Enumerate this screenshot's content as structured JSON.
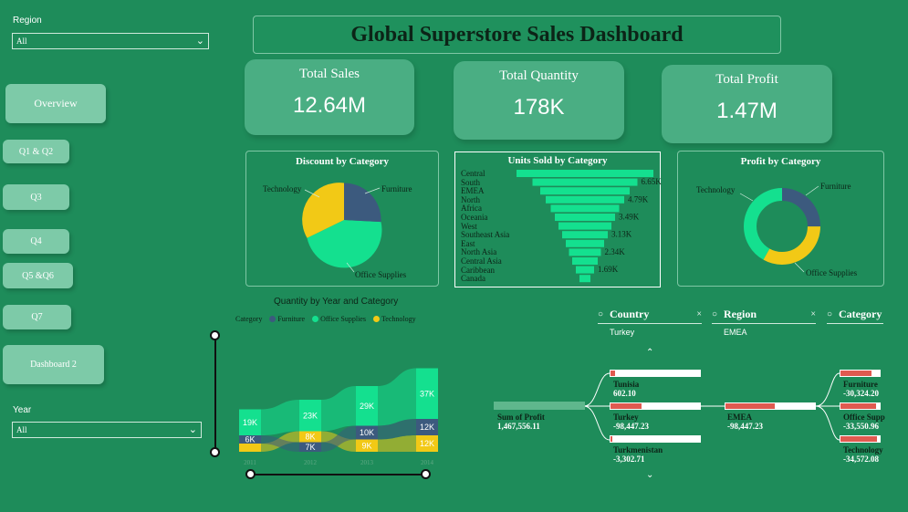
{
  "title": "Global Superstore Sales Dashboard",
  "slicers": {
    "region_label": "Region",
    "region_value": "All",
    "year_label": "Year",
    "year_value": "All"
  },
  "nav": {
    "overview": "Overview",
    "q1q2": "Q1 & Q2",
    "q3": "Q3",
    "q4": "Q4",
    "q5q6": "Q5 &Q6",
    "q7": "Q7",
    "dashboard2": "Dashboard 2"
  },
  "kpis": {
    "sales_label": "Total Sales",
    "sales_value": "12.64M",
    "qty_label": "Total Quantity",
    "qty_value": "178K",
    "profit_label": "Total Profit",
    "profit_value": "1.47M"
  },
  "discount_chart": {
    "title": "Discount by Category",
    "labels": {
      "tech": "Technology",
      "furn": "Furniture",
      "office": "Office Supplies"
    }
  },
  "units_chart": {
    "title": "Units Sold by Category",
    "rows": [
      "Central",
      "South",
      "EMEA",
      "North",
      "Africa",
      "Oceania",
      "West",
      "Southeast Asia",
      "East",
      "North Asia",
      "Central Asia",
      "Caribbean",
      "Canada"
    ],
    "values": [
      "6.65K",
      "4.79K",
      "3.49K",
      "3.13K",
      "2.34K",
      "1.69K"
    ]
  },
  "profit_chart": {
    "title": "Profit by Category",
    "labels": {
      "tech": "Technology",
      "furn": "Furniture",
      "office": "Office Supplies"
    }
  },
  "ribbon_chart": {
    "title": "Quantity by Year and Category",
    "legend_title": "Category",
    "legend": [
      "Furniture",
      "Office Supplies",
      "Technology"
    ],
    "years": [
      "2011",
      "2012",
      "2013",
      "2014"
    ],
    "labels": {
      "office": [
        "19K",
        "23K",
        "29K",
        "37K"
      ],
      "tech": [
        "",
        "8K",
        "9K",
        "12K"
      ],
      "furn": [
        "6K",
        "7K",
        "10K",
        "12K"
      ]
    }
  },
  "chart_data": [
    {
      "type": "pie",
      "title": "Discount by Category",
      "labels": [
        "Office Supplies",
        "Technology",
        "Furniture"
      ],
      "values": [
        65,
        17,
        18
      ]
    },
    {
      "type": "bar",
      "title": "Units Sold by Category",
      "categories": [
        "Central",
        "South",
        "EMEA",
        "North",
        "Africa",
        "Oceania",
        "West",
        "Southeast Asia",
        "East",
        "North Asia",
        "Central Asia",
        "Caribbean",
        "Canada"
      ],
      "value_labels": [
        "6.65K",
        "4.79K",
        "3.49K",
        "3.13K",
        "2.34K",
        "1.69K"
      ]
    },
    {
      "type": "pie",
      "title": "Profit by Category",
      "labels": [
        "Office Supplies",
        "Technology",
        "Furniture"
      ],
      "values": [
        42,
        33,
        25
      ]
    },
    {
      "type": "area",
      "title": "Quantity by Year and Category",
      "x": [
        "2011",
        "2012",
        "2013",
        "2014"
      ],
      "series": [
        {
          "name": "Furniture",
          "values": [
            6,
            7,
            10,
            12
          ]
        },
        {
          "name": "Office Supplies",
          "values": [
            19,
            23,
            29,
            37
          ]
        },
        {
          "name": "Technology",
          "values": [
            6,
            8,
            9,
            12
          ]
        }
      ]
    }
  ],
  "decomp": {
    "headers": {
      "country": "Country",
      "region": "Region",
      "category": "Category"
    },
    "selected": {
      "country": "Turkey",
      "region": "EMEA"
    },
    "root_label": "Sum of Profit",
    "root_value": "1,467,556.11",
    "countries": [
      {
        "name": "Tunisia",
        "value": "602.10",
        "fill": 0.05
      },
      {
        "name": "Turkey",
        "value": "-98,447.23",
        "fill": 0.35
      },
      {
        "name": "Turkmenistan",
        "value": "-3,302.71",
        "fill": 0.02
      }
    ],
    "region": {
      "name": "EMEA",
      "value": "-98,447.23",
      "fill": 0.55
    },
    "categories": [
      {
        "name": "Furniture",
        "value": "-30,324.20",
        "fill": 0.8
      },
      {
        "name": "Office Supp",
        "value": "-33,550.96",
        "fill": 0.9
      },
      {
        "name": "Technology",
        "value": "-34,572.08",
        "fill": 0.92
      }
    ]
  },
  "colors": {
    "background": "#1e8c5a",
    "office": "#14e08f",
    "furniture": "#3c5a7e",
    "technology": "#f2c916",
    "negative": "#e05a50"
  }
}
